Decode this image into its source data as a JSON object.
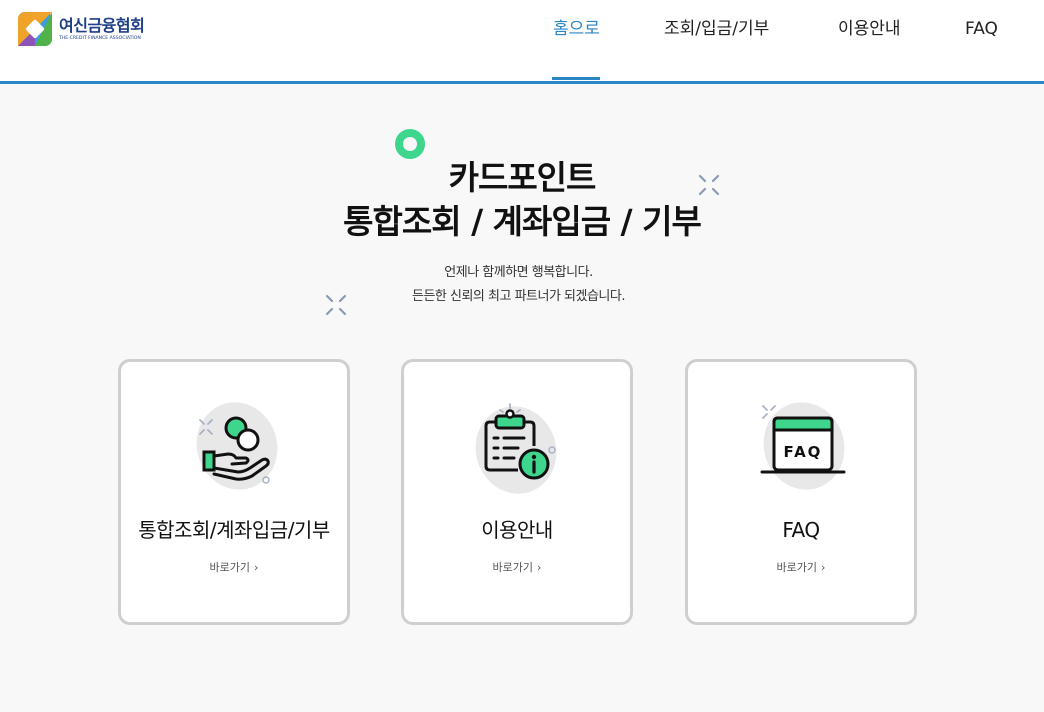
{
  "header": {
    "logo_ko": "여신금융협회",
    "logo_en": "THE CREDIT FINANCE ASSOCIATION",
    "nav": [
      "홈으로",
      "조회/입금/기부",
      "이용안내",
      "FAQ"
    ],
    "active_index": 0
  },
  "hero": {
    "title_line1": "카드포인트",
    "title_line2": "통합조회 / 계좌입금 / 기부",
    "sub_line1": "언제나 함께하면 행복합니다.",
    "sub_line2": "든든한 신뢰의 최고 파트너가 되겠습니다."
  },
  "cards": [
    {
      "title": "통합조회/계좌입금/기부",
      "link": "바로가기",
      "icon": "hand-coins-icon"
    },
    {
      "title": "이용안내",
      "link": "바로가기",
      "icon": "clipboard-info-icon"
    },
    {
      "title": "FAQ",
      "link": "바로가기",
      "icon": "faq-window-icon"
    }
  ],
  "colors": {
    "accent_blue": "#2a86c5",
    "accent_green": "#3dd68c",
    "card_border": "#cfcfcf"
  }
}
